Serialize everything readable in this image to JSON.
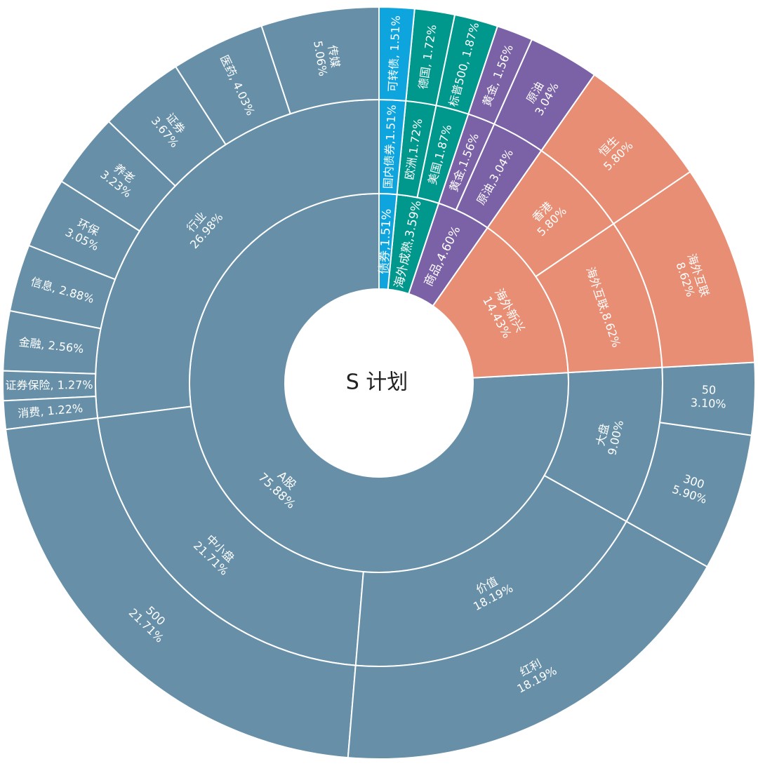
{
  "chart_data": {
    "type": "sunburst",
    "title": "S 计划",
    "colors": {
      "A股": "#6790a8",
      "海外新兴": "#e88e74",
      "商品": "#7b62a6",
      "海外成熟": "#00978c",
      "债券": "#0ea5df"
    },
    "rings": [
      {
        "level": 1,
        "segments": [
          {
            "name": "A股",
            "value": 75.88,
            "top": "A股",
            "label": [
              "A股",
              "75.88%"
            ]
          },
          {
            "name": "海外新兴",
            "value": 14.43,
            "top": "海外新兴",
            "label": [
              "海外新兴",
              "14.43%"
            ]
          },
          {
            "name": "商品",
            "value": 4.6,
            "top": "商品",
            "label": [
              "商品,4.60%"
            ]
          },
          {
            "name": "海外成熟",
            "value": 3.59,
            "top": "海外成熟",
            "label": [
              "海外成熟,3.59%"
            ]
          },
          {
            "name": "债券",
            "value": 1.51,
            "top": "债券",
            "label": [
              "债券,1.51%"
            ]
          }
        ]
      },
      {
        "level": 2,
        "segments": [
          {
            "name": "行业",
            "value": 26.98,
            "top": "A股",
            "label": [
              "行业",
              "26.98%"
            ]
          },
          {
            "name": "中小盘",
            "value": 21.71,
            "top": "A股",
            "label": [
              "中小盘",
              "21.71%"
            ]
          },
          {
            "name": "价值",
            "value": 18.19,
            "top": "A股",
            "label": [
              "价值",
              "18.19%"
            ]
          },
          {
            "name": "大盘",
            "value": 9.0,
            "top": "A股",
            "label": [
              "大盘",
              "9.00%"
            ]
          },
          {
            "name": "海外互联",
            "value": 8.62,
            "top": "海外新兴",
            "label": [
              "海外互联,8.62%"
            ]
          },
          {
            "name": "香港",
            "value": 5.8,
            "top": "海外新兴",
            "label": [
              "香港",
              "5.80%"
            ]
          },
          {
            "name": "原油",
            "value": 3.04,
            "top": "商品",
            "label": [
              "原油,3.04%"
            ]
          },
          {
            "name": "黄金",
            "value": 1.56,
            "top": "商品",
            "label": [
              "黄金,1.56%"
            ]
          },
          {
            "name": "美国",
            "value": 1.87,
            "top": "海外成熟",
            "label": [
              "美国,1.87%"
            ]
          },
          {
            "name": "欧洲",
            "value": 1.72,
            "top": "海外成熟",
            "label": [
              "欧洲,1.72%"
            ]
          },
          {
            "name": "国内债券",
            "value": 1.51,
            "top": "债券",
            "label": [
              "国内债券,1.51%"
            ]
          }
        ]
      },
      {
        "level": 3,
        "segments": [
          {
            "name": "传媒",
            "value": 5.06,
            "top": "A股",
            "label": [
              "传媒",
              "5.06%"
            ]
          },
          {
            "name": "医药",
            "value": 4.03,
            "top": "A股",
            "label": [
              "医药, 4.03%"
            ]
          },
          {
            "name": "证券",
            "value": 3.67,
            "top": "A股",
            "label": [
              "证券",
              "3.67%"
            ]
          },
          {
            "name": "养老",
            "value": 3.23,
            "top": "A股",
            "label": [
              "养老",
              "3.23%"
            ]
          },
          {
            "name": "环保",
            "value": 3.05,
            "top": "A股",
            "label": [
              "环保",
              "3.05%"
            ]
          },
          {
            "name": "信息",
            "value": 2.88,
            "top": "A股",
            "label": [
              "信息, 2.88%"
            ]
          },
          {
            "name": "金融",
            "value": 2.56,
            "top": "A股",
            "label": [
              "金融, 2.56%"
            ]
          },
          {
            "name": "证券保险",
            "value": 1.27,
            "top": "A股",
            "label": [
              "证券保险, 1.27%"
            ]
          },
          {
            "name": "消费",
            "value": 1.22,
            "top": "A股",
            "label": [
              "消费, 1.22%"
            ]
          },
          {
            "name": "500",
            "value": 21.71,
            "top": "A股",
            "label": [
              "500",
              "21.71%"
            ]
          },
          {
            "name": "红利",
            "value": 18.19,
            "top": "A股",
            "label": [
              "红利",
              "18.19%"
            ]
          },
          {
            "name": "300",
            "value": 5.9,
            "top": "A股",
            "label": [
              "300",
              "5.90%"
            ]
          },
          {
            "name": "50",
            "value": 3.1,
            "top": "A股",
            "label": [
              "50",
              "3.10%"
            ]
          },
          {
            "name": "海外互联",
            "value": 8.62,
            "top": "海外新兴",
            "label": [
              "海外互联",
              "8.62%"
            ]
          },
          {
            "name": "恒生",
            "value": 5.8,
            "top": "海外新兴",
            "label": [
              "恒生",
              "5.80%"
            ]
          },
          {
            "name": "原油",
            "value": 3.04,
            "top": "商品",
            "label": [
              "原油",
              "3.04%"
            ]
          },
          {
            "name": "黄金",
            "value": 1.56,
            "top": "商品",
            "label": [
              "黄金, 1.56%"
            ]
          },
          {
            "name": "标普500",
            "value": 1.87,
            "top": "海外成熟",
            "label": [
              "标普500, 1.87%"
            ]
          },
          {
            "name": "德国",
            "value": 1.72,
            "top": "海外成熟",
            "label": [
              "德国, 1.72%"
            ]
          },
          {
            "name": "可转债",
            "value": 1.51,
            "top": "债券",
            "label": [
              "可转债, 1.51%"
            ]
          }
        ]
      }
    ]
  }
}
